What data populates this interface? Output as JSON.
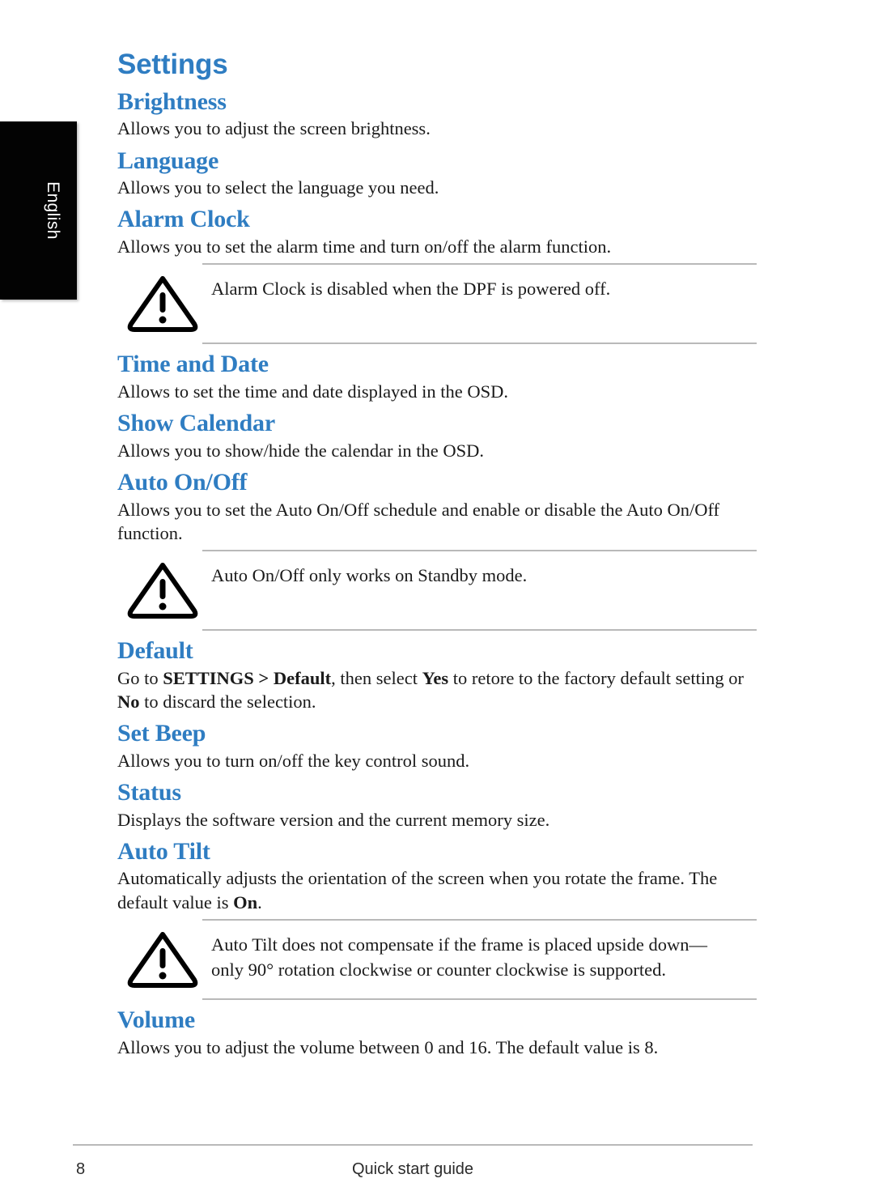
{
  "accent_color": "#2f7dc2",
  "rule_color": "#b9b9b9",
  "side_tab": {
    "label": "English",
    "background": "#030303",
    "text_color": "#ffffff"
  },
  "doc": {
    "title": "Settings"
  },
  "sections": [
    {
      "heading": "Brightness",
      "body": "Allows you to adjust the screen brightness."
    },
    {
      "heading": "Language",
      "body": "Allows you to select the language you need."
    },
    {
      "heading": "Alarm Clock",
      "body": "Allows you to set the alarm time and turn on/off the alarm function.",
      "note": "Alarm Clock is disabled when the DPF is powered off.",
      "note_icon": "warning-triangle-icon"
    },
    {
      "heading": "Time and Date",
      "body": "Allows to set the time and date displayed in the OSD."
    },
    {
      "heading": "Show Calendar",
      "body": "Allows you to show/hide the calendar in the OSD."
    },
    {
      "heading": "Auto On/Off",
      "body": "Allows you to set the Auto On/Off schedule and enable or disable the Auto On/Off function.",
      "note": "Auto On/Off only works on Standby mode.",
      "note_icon": "warning-triangle-icon"
    },
    {
      "heading": "Default",
      "body_parts": [
        {
          "text": "Go to ",
          "bold": false
        },
        {
          "text": "SETTINGS > Default",
          "bold": true
        },
        {
          "text": ", then select ",
          "bold": false
        },
        {
          "text": "Yes",
          "bold": true
        },
        {
          "text": " to retore to the factory default setting or ",
          "bold": false
        },
        {
          "text": "No",
          "bold": true
        },
        {
          "text": " to discard the selection.",
          "bold": false
        }
      ]
    },
    {
      "heading": "Set Beep",
      "body": "Allows you to turn on/off the key control sound."
    },
    {
      "heading": "Status",
      "body": "Displays the software version and the current memory size."
    },
    {
      "heading": "Auto Tilt",
      "body_parts": [
        {
          "text": "Automatically adjusts the orientation of the screen when you rotate the frame. The default value is ",
          "bold": false
        },
        {
          "text": "On",
          "bold": true
        },
        {
          "text": ".",
          "bold": false
        }
      ],
      "note": "Auto Tilt does not compensate if the frame is placed upside down—only 90° rotation clockwise or counter clockwise is supported.",
      "note_icon": "warning-triangle-icon"
    },
    {
      "heading": "Volume",
      "body": "Allows you to adjust the volume between 0 and 16. The default value is 8."
    }
  ],
  "footer": {
    "page_number": "8",
    "center_label": "Quick start guide"
  }
}
